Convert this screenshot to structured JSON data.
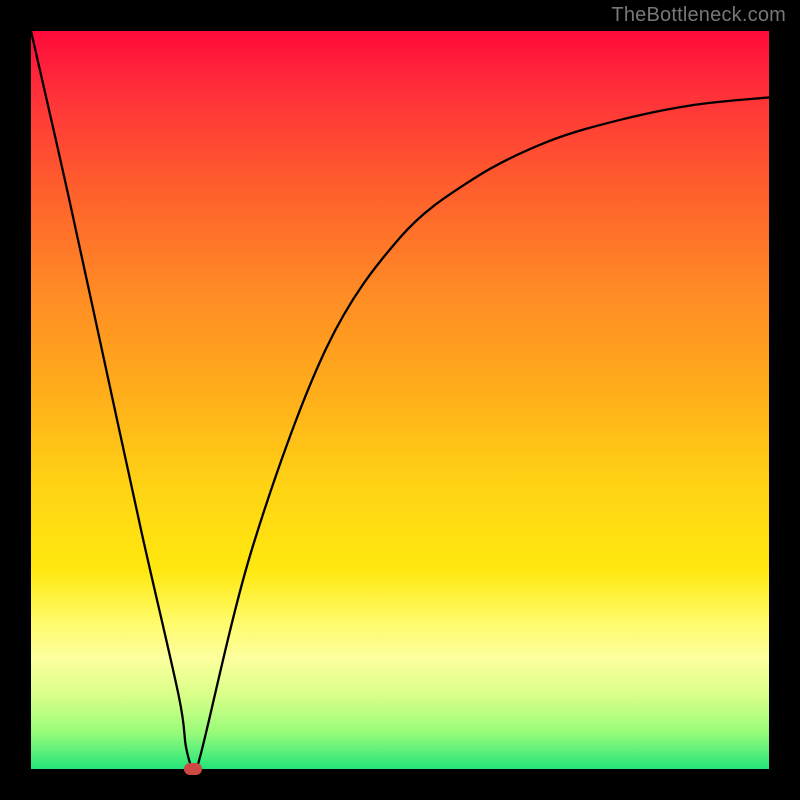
{
  "watermark": "TheBottleneck.com",
  "colors": {
    "frame": "#000000",
    "curve": "#000000",
    "marker": "#cc4a43",
    "gradient": [
      "#ff0a3a",
      "#ff5a2e",
      "#ffb01a",
      "#ffe80f",
      "#fcff9e",
      "#23e47a"
    ]
  },
  "chart_data": {
    "type": "line",
    "title": "",
    "xlabel": "",
    "ylabel": "",
    "xlim": [
      0,
      100
    ],
    "ylim": [
      0,
      100
    ],
    "grid": false,
    "series": [
      {
        "name": "curve",
        "x": [
          0,
          5,
          10,
          15,
          20,
          21,
          22,
          23,
          30,
          40,
          50,
          60,
          70,
          80,
          90,
          100
        ],
        "y": [
          100,
          78,
          55,
          32,
          10,
          3,
          0,
          2,
          30,
          57,
          72,
          80,
          85,
          88,
          90,
          91
        ]
      }
    ],
    "marker": {
      "x": 22,
      "y": 0
    }
  }
}
